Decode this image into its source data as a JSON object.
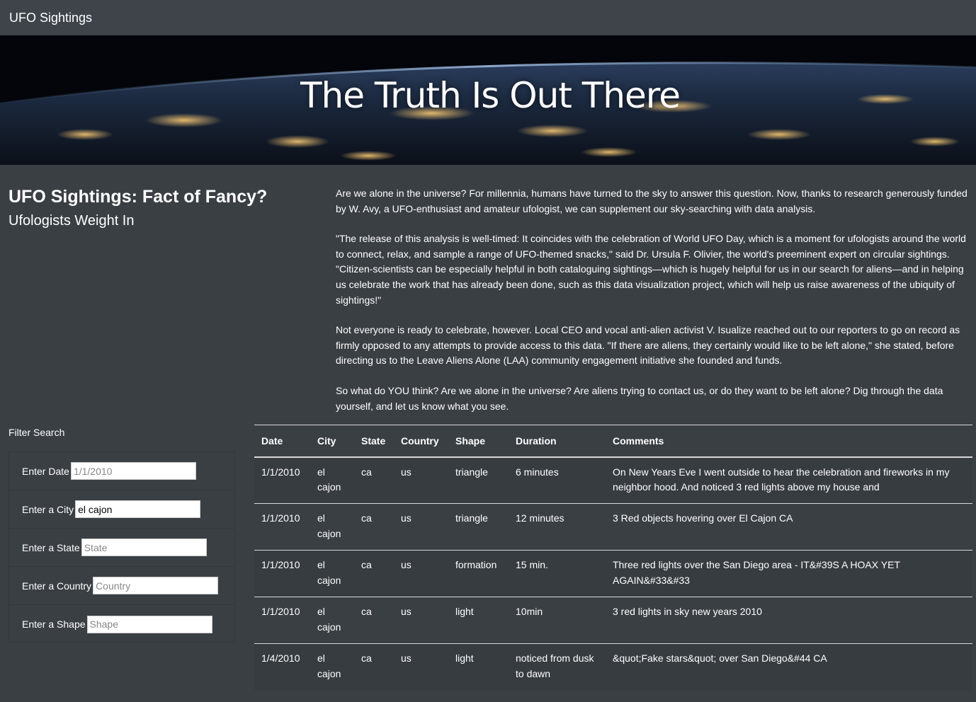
{
  "navbar": {
    "brand": "UFO Sightings"
  },
  "hero": {
    "title": "The Truth Is Out There"
  },
  "article": {
    "title_main": "UFO Sightings: Fact of Fancy?",
    "title_sub": "Ufologists Weight In",
    "paragraphs": [
      "Are we alone in the universe? For millennia, humans have turned to the sky to answer this question. Now, thanks to research generously funded by W. Avy, a UFO-enthusiast and amateur ufologist, we can supplement our sky-searching with data analysis.",
      "\"The release of this analysis is well-timed: It coincides with the celebration of World UFO Day, which is a moment for ufologists around the world to connect, relax, and sample a range of UFO-themed snacks,\" said Dr. Ursula F. Olivier, the world's preeminent expert on circular sightings. \"Citizen-scientists can be especially helpful in both cataloguing sightings—which is hugely helpful for us in our search for aliens—and in helping us celebrate the work that has already been done, such as this data visualization project, which will help us raise awareness of the ubiquity of sightings!\"",
      "Not everyone is ready to celebrate, however. Local CEO and vocal anti-alien activist V. Isualize reached out to our reporters to go on record as firmly opposed to any attempts to provide access to this data. \"If there are aliens, they certainly would like to be left alone,\" she stated, before directing us to the Leave Aliens Alone (LAA) community engagement initiative she founded and funds.",
      "So what do YOU think? Are we alone in the universe? Are aliens trying to contact us, or do they want to be left alone? Dig through the data yourself, and let us know what you see."
    ]
  },
  "filters": {
    "heading": "Filter Search",
    "fields": [
      {
        "label": "Enter Date",
        "value": "",
        "placeholder": "1/1/2010"
      },
      {
        "label": "Enter a City",
        "value": "el cajon",
        "placeholder": ""
      },
      {
        "label": "Enter a State",
        "value": "",
        "placeholder": "State"
      },
      {
        "label": "Enter a Country",
        "value": "",
        "placeholder": "Country"
      },
      {
        "label": "Enter a Shape",
        "value": "",
        "placeholder": "Shape"
      }
    ]
  },
  "table": {
    "headers": [
      "Date",
      "City",
      "State",
      "Country",
      "Shape",
      "Duration",
      "Comments"
    ],
    "rows": [
      [
        "1/1/2010",
        "el cajon",
        "ca",
        "us",
        "triangle",
        "6 minutes",
        "On New Years Eve I went outside to hear the celebration and fireworks in my neighbor hood. And noticed 3 red lights above my house and"
      ],
      [
        "1/1/2010",
        "el cajon",
        "ca",
        "us",
        "triangle",
        "12 minutes",
        "3 Red objects hovering over El Cajon CA"
      ],
      [
        "1/1/2010",
        "el cajon",
        "ca",
        "us",
        "formation",
        "15 min.",
        "Three red lights over the San Diego area - IT&#39S A HOAX YET AGAIN&#33&#33"
      ],
      [
        "1/1/2010",
        "el cajon",
        "ca",
        "us",
        "light",
        "10min",
        "3 red lights in sky new years 2010"
      ],
      [
        "1/4/2010",
        "el cajon",
        "ca",
        "us",
        "light",
        "noticed from dusk to dawn",
        "&quot;Fake stars&quot; over San Diego&#44 CA"
      ]
    ]
  }
}
